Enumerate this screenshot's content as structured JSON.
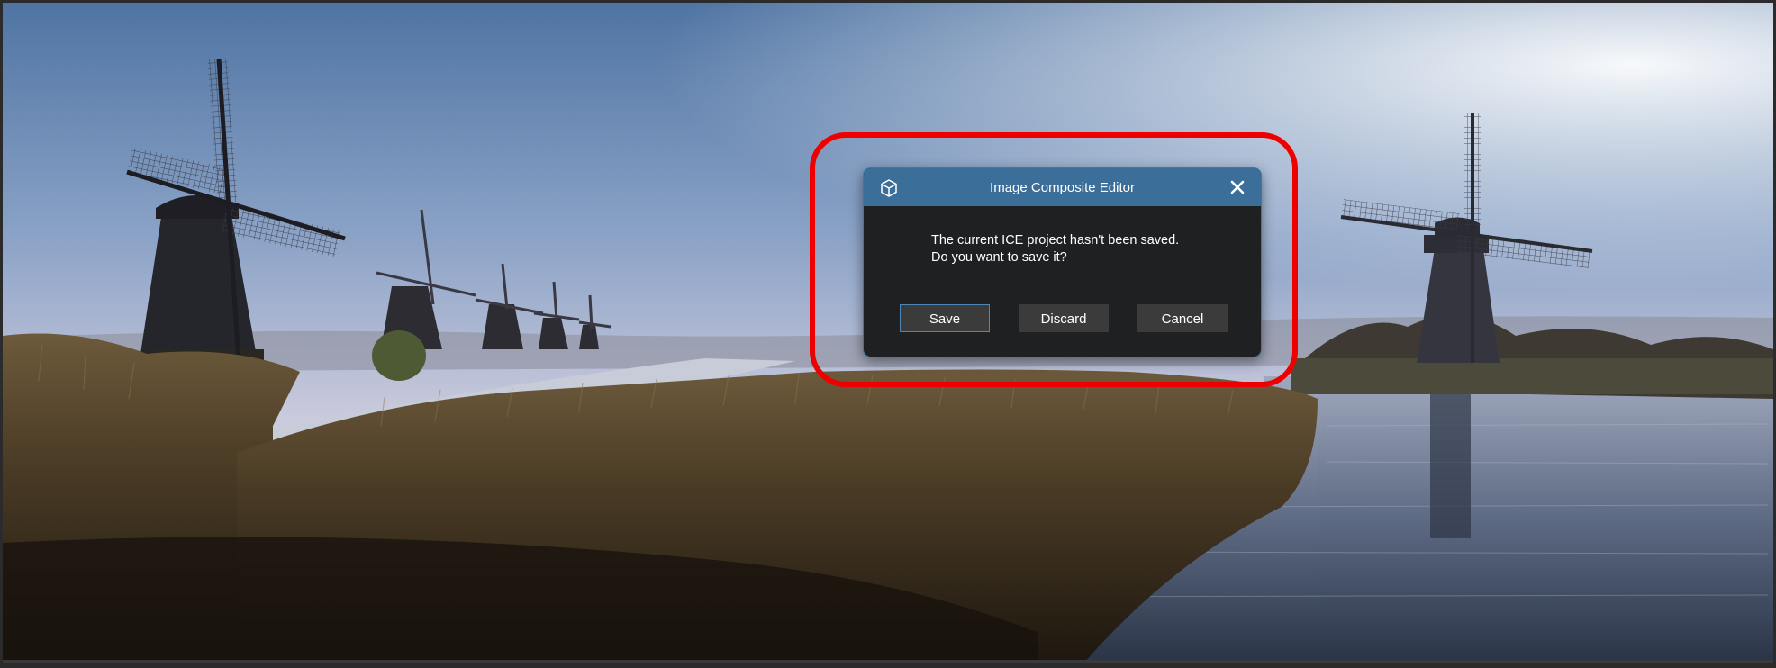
{
  "background": {
    "description_icon": "windmills-landscape-photo"
  },
  "dialog": {
    "title": "Image Composite Editor",
    "app_icon": "cube-icon",
    "close_icon": "close-icon",
    "message_line1": "The current ICE project hasn't been saved.",
    "message_line2": "Do you want to save it?",
    "buttons": {
      "save": "Save",
      "discard": "Discard",
      "cancel": "Cancel"
    },
    "title_bar_color": "#3c6e9a",
    "body_color": "#1f2021"
  },
  "annotation": {
    "highlight_color": "#ee0000"
  }
}
